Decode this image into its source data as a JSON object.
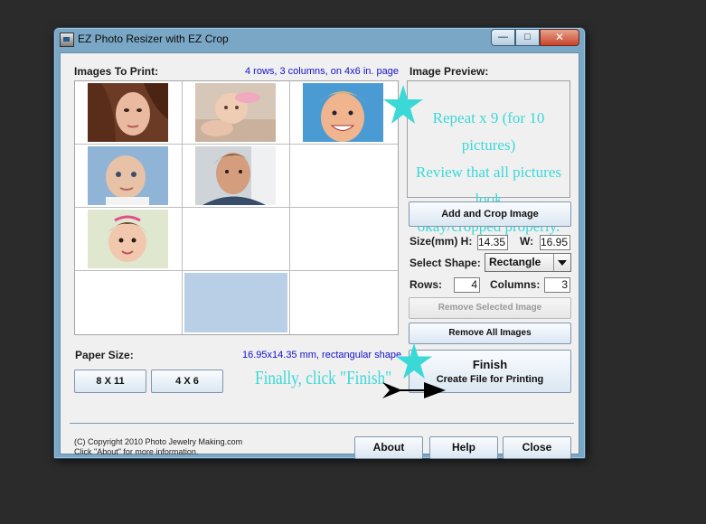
{
  "window": {
    "title": "EZ Photo Resizer with EZ Crop",
    "controls": {
      "minimize": "—",
      "maximize": "□",
      "close": "✕"
    }
  },
  "images_panel": {
    "label": "Images To Print:",
    "layout_info": "4 rows, 3 columns, on 4x6 in. page"
  },
  "preview": {
    "label": "Image Preview:",
    "annotation_lines": [
      "Repeat x 9 (for 10 pictures)",
      "Review that all pictures look",
      "okay/cropped properly."
    ]
  },
  "buttons": {
    "add_crop": "Add and Crop Image",
    "remove_selected": "Remove Selected Image",
    "remove_all": "Remove All Images",
    "finish_title": "Finish",
    "finish_sub": "Create File for Printing",
    "paper_8x11": "8 X 11",
    "paper_4x6": "4 X 6",
    "about": "About",
    "help": "Help",
    "close": "Close"
  },
  "size": {
    "label": "Size(mm) H:",
    "h_value": "14.35",
    "w_label": "W:",
    "w_value": "16.95"
  },
  "shape": {
    "label": "Select Shape:",
    "selected": "Rectangle"
  },
  "rows": {
    "label": "Rows:",
    "value": "4"
  },
  "columns": {
    "label": "Columns:",
    "value": "3"
  },
  "paper": {
    "label": "Paper Size:",
    "info": "16.95x14.35 mm, rectangular shape"
  },
  "annotation_finish": "Finally, click \"Finish\"",
  "copyright": {
    "line1": "(C) Copyright 2010 Photo Jewelry Making.com",
    "line2": "Click \"About\" for more information."
  },
  "colors": {
    "annotation": "#3ad9d7",
    "info_text": "#1111cc",
    "selected_cell": "#b9cfe6"
  }
}
